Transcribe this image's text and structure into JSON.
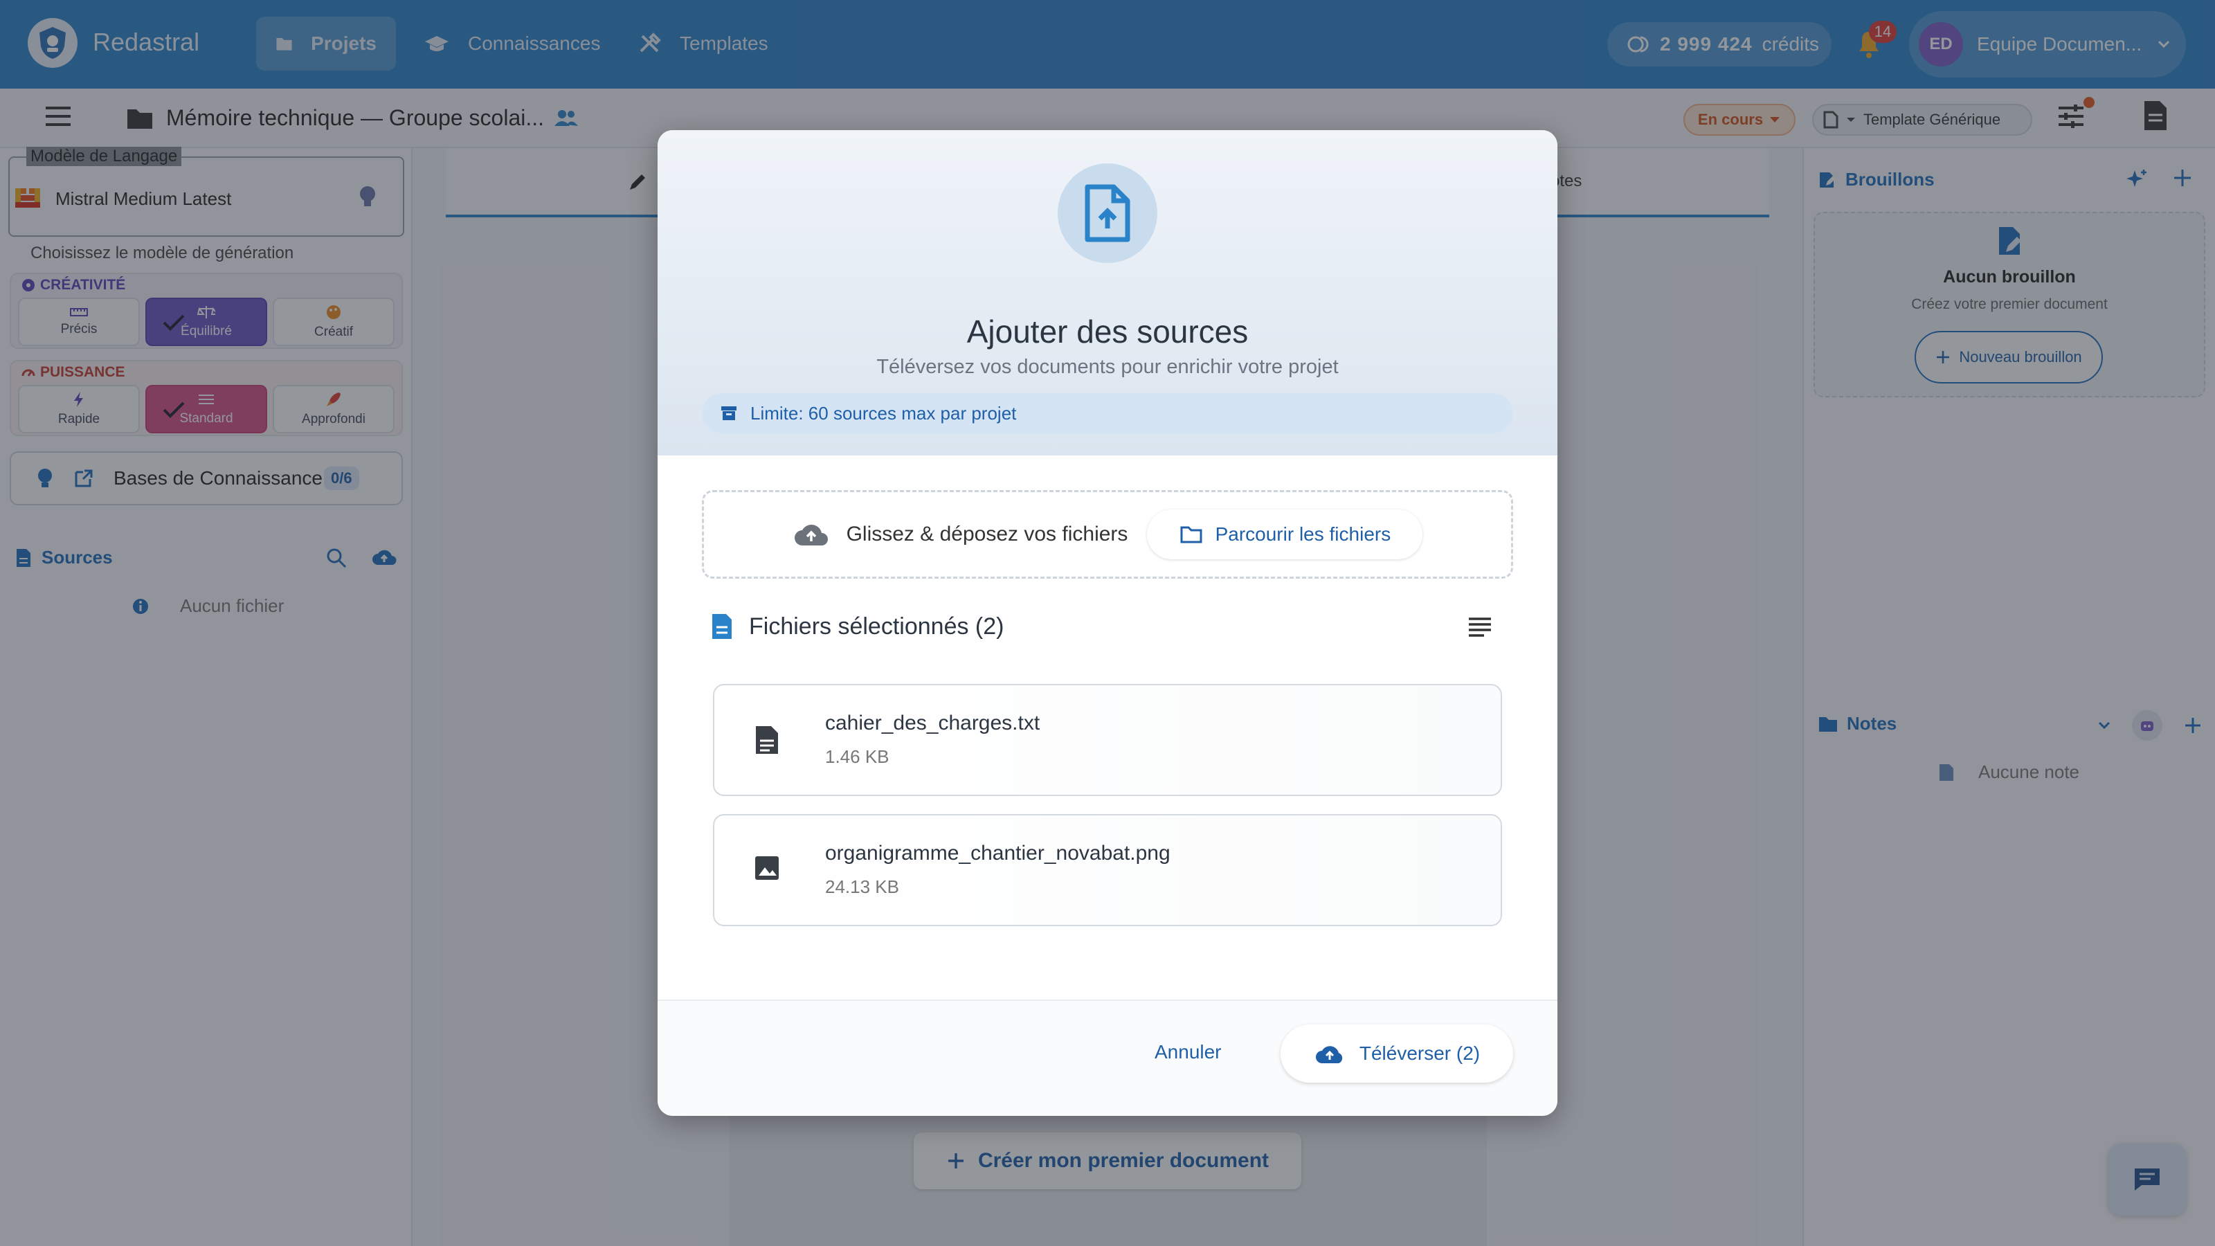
{
  "app": {
    "name": "Redastral"
  },
  "nav": [
    {
      "label": "Projets"
    },
    {
      "label": "Connaissances"
    },
    {
      "label": "Templates"
    }
  ],
  "credits": {
    "amount": "2 999 424",
    "unit": "crédits"
  },
  "notifications": {
    "count": "14"
  },
  "user": {
    "initials": "ED",
    "name": "Equipe Documen..."
  },
  "toolbar": {
    "doc_title": "Mémoire technique — Groupe scolai...",
    "status": "En cours",
    "template": "Template Générique"
  },
  "left": {
    "model_legend": "Modèle de Langage",
    "model_name": "Mistral Medium Latest",
    "model_hint": "Choisissez le modèle de génération",
    "creativity": {
      "label": "CRÉATIVITÉ",
      "options": [
        "Précis",
        "Équilibré",
        "Créatif"
      ],
      "selected": "Équilibré"
    },
    "power": {
      "label": "PUISSANCE",
      "options": [
        "Rapide",
        "Standard",
        "Approfondi"
      ],
      "selected": "Standard"
    },
    "kb_label": "Bases de Connaissance",
    "kb_count": "0/6",
    "sources_label": "Sources",
    "no_file": "Aucun fichier"
  },
  "center": {
    "tab_notes_partial": "otes",
    "create_button": "Créer mon premier document"
  },
  "right": {
    "brouillons": "Brouillons",
    "empty_title": "Aucun brouillon",
    "empty_sub": "Créez votre premier document",
    "new_draft": "Nouveau brouillon",
    "notes": "Notes",
    "no_note": "Aucune note"
  },
  "dialog": {
    "title": "Ajouter des sources",
    "subtitle": "Téléversez vos documents pour enrichir votre projet",
    "limit": "Limite: 60 sources max par projet",
    "dropzone_text": "Glissez & déposez vos fichiers",
    "browse": "Parcourir les fichiers",
    "selected_header": "Fichiers sélectionnés (2)",
    "files": [
      {
        "name": "cahier_des_charges.txt",
        "size": "1.46 KB",
        "icon": "text-file-icon"
      },
      {
        "name": "organigramme_chantier_novabat.png",
        "size": "24.13 KB",
        "icon": "image-file-icon"
      }
    ],
    "cancel": "Annuler",
    "upload": "Téléverser (2)"
  },
  "colors": {
    "primary": "#2a82c9",
    "link": "#1f5fa8",
    "creativity_selected": "#6a55c4",
    "power_selected": "#d84e86",
    "status_orange": "#d24f16"
  }
}
